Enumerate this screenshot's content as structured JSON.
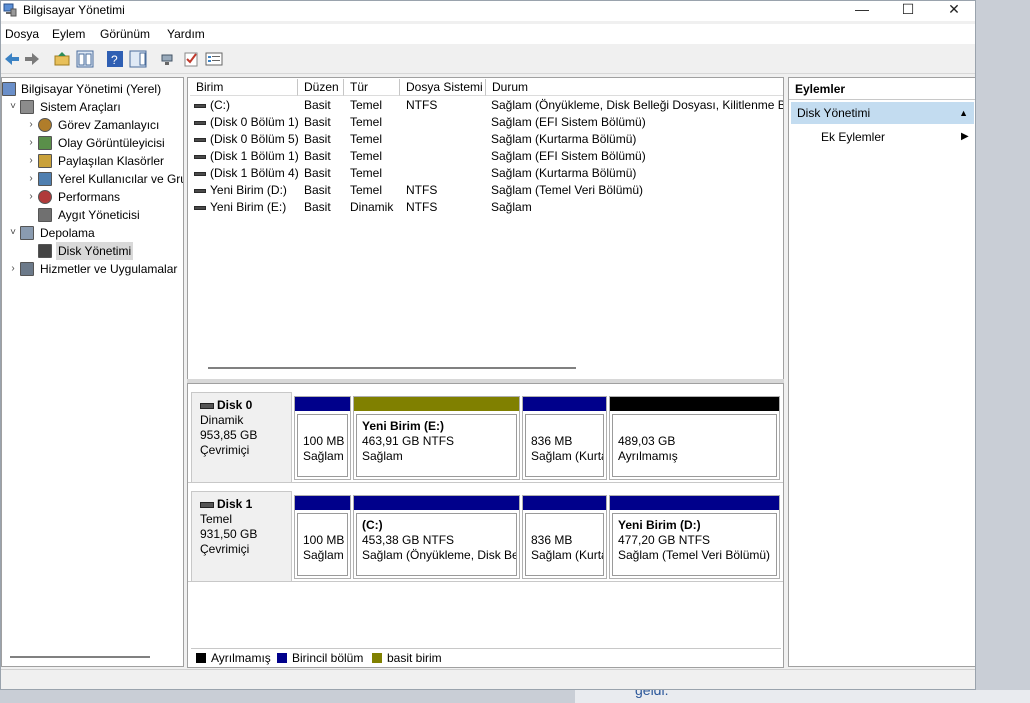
{
  "window": {
    "title": "Bilgisayar Yönetimi",
    "controls": {
      "minimize": "—",
      "maximize": "☐",
      "close": "✕"
    }
  },
  "menu": [
    "Dosya",
    "Eylem",
    "Görünüm",
    "Yardım"
  ],
  "toolbar": [
    "back-icon",
    "forward-icon",
    "up-folder-icon",
    "show-hide-tree-icon",
    "help-icon",
    "action-pane-icon",
    "connect-icon",
    "check-icon",
    "properties-icon"
  ],
  "tree": {
    "items": [
      {
        "label": "Bilgisayar Yönetimi (Yerel)",
        "level": 0,
        "expander": "",
        "icon": "computer-management-icon"
      },
      {
        "label": "Sistem Araçları",
        "level": 1,
        "expander": "˅",
        "icon": "system-tools-icon"
      },
      {
        "label": "Görev Zamanlayıcı",
        "level": 2,
        "expander": "›",
        "icon": "task-scheduler-icon"
      },
      {
        "label": "Olay Görüntüleyicisi",
        "level": 2,
        "expander": "›",
        "icon": "event-viewer-icon"
      },
      {
        "label": "Paylaşılan Klasörler",
        "level": 2,
        "expander": "›",
        "icon": "shared-folders-icon"
      },
      {
        "label": "Yerel Kullanıcılar ve Gru",
        "level": 2,
        "expander": "›",
        "icon": "local-users-icon"
      },
      {
        "label": "Performans",
        "level": 2,
        "expander": "›",
        "icon": "performance-icon"
      },
      {
        "label": "Aygıt Yöneticisi",
        "level": 2,
        "expander": "",
        "icon": "device-manager-icon"
      },
      {
        "label": "Depolama",
        "level": 1,
        "expander": "˅",
        "icon": "storage-icon"
      },
      {
        "label": "Disk Yönetimi",
        "level": 2,
        "expander": "",
        "icon": "disk-management-icon",
        "selected": true
      },
      {
        "label": "Hizmetler ve Uygulamalar",
        "level": 1,
        "expander": "›",
        "icon": "services-icon"
      }
    ]
  },
  "volume_list": {
    "columns": [
      "Birim",
      "Düzen",
      "Tür",
      "Dosya Sistemi",
      "Durum"
    ],
    "rows": [
      [
        "(C:)",
        "Basit",
        "Temel",
        "NTFS",
        "Sağlam (Önyükleme, Disk Belleği Dosyası, Kilitlenme Bil"
      ],
      [
        "(Disk 0 Bölüm 1)",
        "Basit",
        "Temel",
        "",
        "Sağlam (EFI Sistem Bölümü)"
      ],
      [
        "(Disk 0 Bölüm 5)",
        "Basit",
        "Temel",
        "",
        "Sağlam (Kurtarma Bölümü)"
      ],
      [
        "(Disk 1 Bölüm 1)",
        "Basit",
        "Temel",
        "",
        "Sağlam (EFI Sistem Bölümü)"
      ],
      [
        "(Disk 1 Bölüm 4)",
        "Basit",
        "Temel",
        "",
        "Sağlam (Kurtarma Bölümü)"
      ],
      [
        "Yeni Birim (D:)",
        "Basit",
        "Temel",
        "NTFS",
        "Sağlam (Temel Veri Bölümü)"
      ],
      [
        "Yeni Birim (E:)",
        "Basit",
        "Dinamik",
        "NTFS",
        "Sağlam"
      ]
    ]
  },
  "disks": [
    {
      "name": "Disk 0",
      "type": "Dinamik",
      "size": "953,85 GB",
      "status": "Çevrimiçi",
      "partitions": [
        {
          "title": "",
          "line1": "100 MB",
          "line2": "Sağlam",
          "bar": "#00008b"
        },
        {
          "title": "Yeni Birim  (E:)",
          "line1": "463,91 GB NTFS",
          "line2": "Sağlam",
          "bar": "#808000"
        },
        {
          "title": "",
          "line1": "836 MB",
          "line2": "Sağlam (Kurta",
          "bar": "#00008b"
        },
        {
          "title": "",
          "line1": "489,03 GB",
          "line2": "Ayrılmamış",
          "bar": "#000000"
        }
      ]
    },
    {
      "name": "Disk 1",
      "type": "Temel",
      "size": "931,50 GB",
      "status": "Çevrimiçi",
      "partitions": [
        {
          "title": "",
          "line1": "100 MB",
          "line2": "Sağlam",
          "bar": "#00008b"
        },
        {
          "title": "(C:)",
          "line1": "453,38 GB NTFS",
          "line2": "Sağlam (Önyükleme, Disk Bel",
          "bar": "#00008b"
        },
        {
          "title": "",
          "line1": "836 MB",
          "line2": "Sağlam (Kurta",
          "bar": "#00008b"
        },
        {
          "title": "Yeni Birim  (D:)",
          "line1": "477,20 GB NTFS",
          "line2": "Sağlam (Temel Veri Bölümü)",
          "bar": "#00008b"
        }
      ]
    }
  ],
  "legend": [
    {
      "label": "Ayrılmamış",
      "color": "#000000"
    },
    {
      "label": "Birincil bölüm",
      "color": "#00008b"
    },
    {
      "label": "basit birim",
      "color": "#808000"
    }
  ],
  "actions": {
    "title": "Eylemler",
    "section": "Disk Yönetimi",
    "section_arrow": "▲",
    "item": "Ek Eylemler",
    "item_arrow": "▶"
  },
  "background_text": "geldi."
}
